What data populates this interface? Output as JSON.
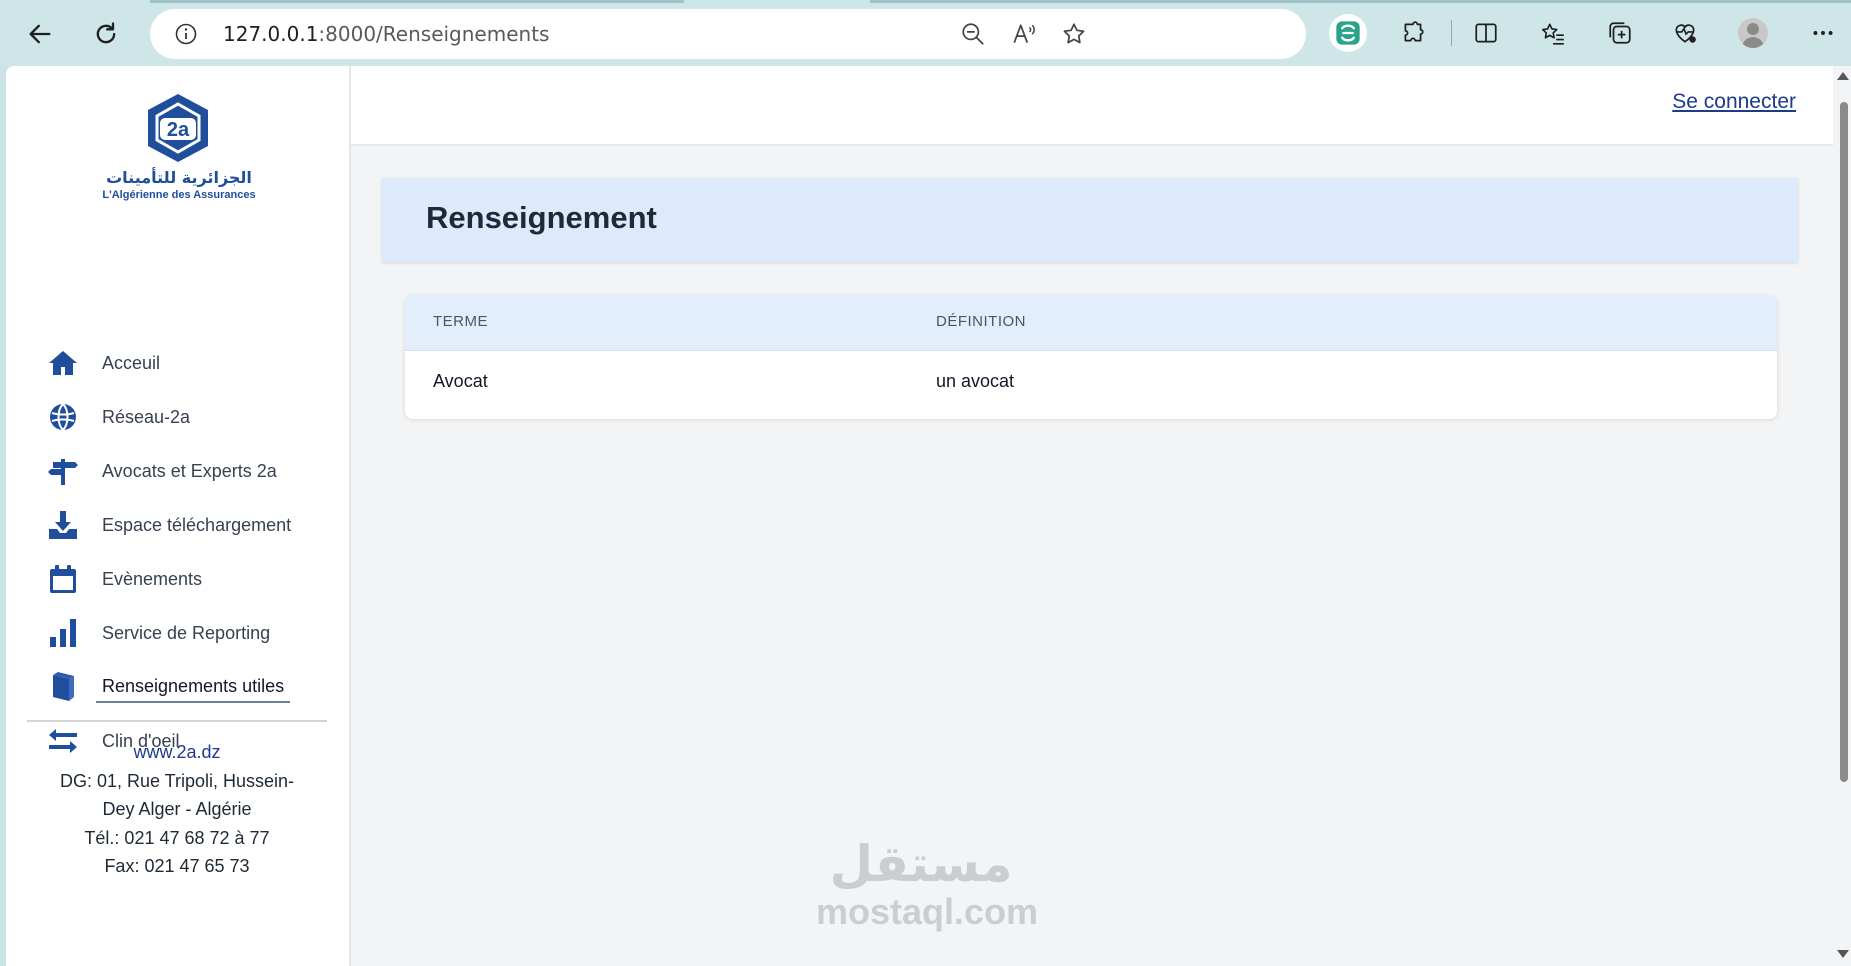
{
  "browser": {
    "url_host": "127.0.0.1",
    "url_path": ":8000/Renseignements",
    "icons": [
      "back-icon",
      "refresh-icon",
      "info-icon",
      "zoom-out-icon",
      "read-aloud-icon",
      "favorite-star-icon",
      "extension-active-icon",
      "extensions-puzzle-icon",
      "split-screen-icon",
      "favorites-list-icon",
      "collections-icon",
      "browser-health-icon",
      "profile-avatar-icon",
      "more-menu-icon"
    ]
  },
  "sidebar": {
    "logo": {
      "mark": "2a",
      "arabic": "الجزائرية للتأمينات",
      "french": "L'Algérienne des Assurances"
    },
    "items": [
      {
        "label": "Acceuil",
        "icon": "home-icon"
      },
      {
        "label": "Réseau-2a",
        "icon": "globe-icon"
      },
      {
        "label": "Avocats et Experts 2a",
        "icon": "signpost-icon"
      },
      {
        "label": "Espace téléchargement",
        "icon": "download-icon"
      },
      {
        "label": "Evènements",
        "icon": "calendar-icon"
      },
      {
        "label": "Service de Reporting",
        "icon": "bar-chart-icon"
      },
      {
        "label": "Renseignements utiles",
        "icon": "book-icon",
        "active": true
      },
      {
        "label": "Clin d'oeil",
        "icon": "exchange-arrows-icon"
      }
    ],
    "contact": {
      "website": "www.2a.dz",
      "address_line1": "DG: 01, Rue Tripoli, Hussein-",
      "address_line2": "Dey Alger - Algérie",
      "phone": "Tél.: 021 47 68 72 à 77",
      "fax": "Fax: 021 47 65 73"
    }
  },
  "topbar": {
    "login_label": "Se connecter"
  },
  "main": {
    "title": "Renseignement",
    "table": {
      "headers": [
        "TERME",
        "DÉFINITION"
      ],
      "rows": [
        [
          "Avocat",
          "un avocat"
        ]
      ]
    }
  },
  "watermark": {
    "arabic": "مستقل",
    "latin": "mostaql.com"
  },
  "colors": {
    "brand_blue": "#1f4e9c",
    "header_bg": "#ddeafc",
    "table_head_bg": "#e3eefc",
    "link_blue": "#1e3a8a"
  }
}
